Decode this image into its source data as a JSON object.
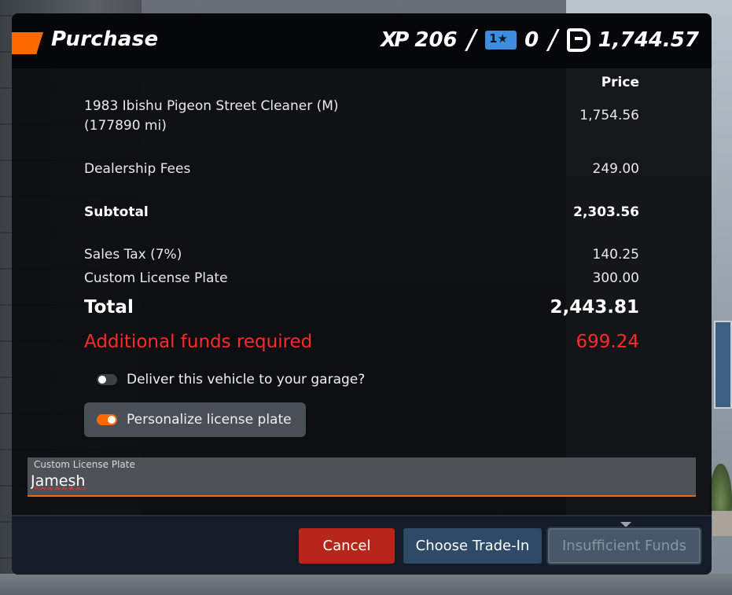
{
  "header": {
    "title": "Purchase",
    "xp_icon": "XP",
    "xp_value": "206",
    "ticket_value": "0",
    "money_value": "1,744.57",
    "separator": "/"
  },
  "price_table": {
    "column_header": "Price",
    "vehicle": {
      "label_line1": "1983 Ibishu Pigeon Street Cleaner (M)",
      "label_line2": "(177890 mi)",
      "value": "1,754.56"
    },
    "fees": {
      "label": "Dealership Fees",
      "value": "249.00"
    },
    "subtotal": {
      "label": "Subtotal",
      "value": "2,303.56"
    },
    "tax": {
      "label": "Sales Tax (7%)",
      "value": "140.25"
    },
    "plate": {
      "label": "Custom License Plate",
      "value": "300.00"
    },
    "total": {
      "label": "Total",
      "value": "2,443.81"
    },
    "additional": {
      "label": "Additional funds required",
      "value": "699.24"
    }
  },
  "options": {
    "deliver": {
      "label": "Deliver this vehicle to your garage?",
      "enabled": false
    },
    "personalize": {
      "label": "Personalize license plate",
      "enabled": true
    }
  },
  "license_plate": {
    "label": "Custom License Plate",
    "value": "Jamesh"
  },
  "buttons": {
    "cancel": "Cancel",
    "trade_in": "Choose Trade-In",
    "purchase": "Insufficient Funds"
  },
  "colors": {
    "accent": "#ff6a00",
    "warning": "#ff2a2a",
    "cancel": "#b7261a",
    "trade_in": "#2e4a66"
  }
}
